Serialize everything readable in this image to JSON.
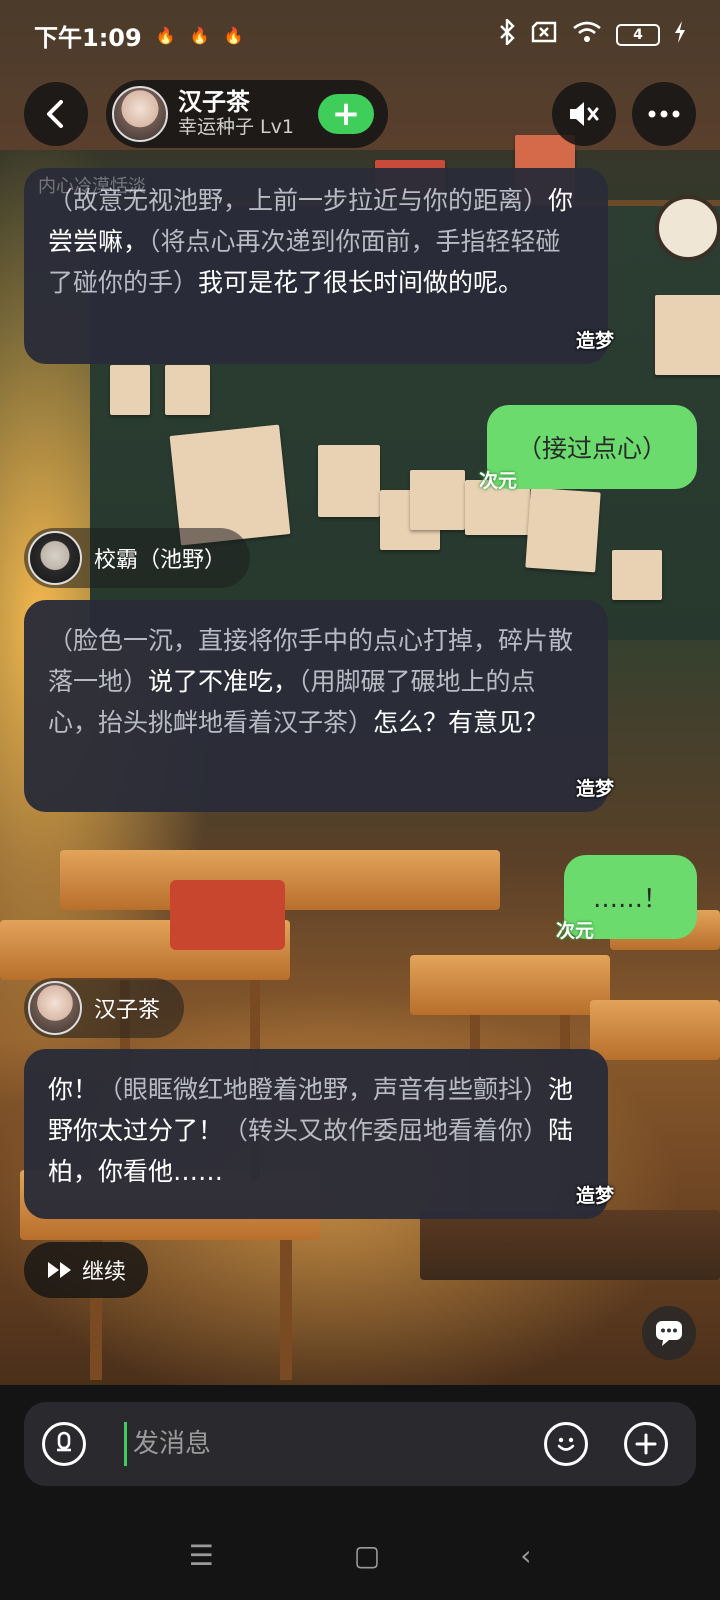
{
  "status_bar": {
    "time": "下午1:09",
    "notification_icons": [
      "flame-icon",
      "flame-icon",
      "flame-icon"
    ],
    "battery": "4"
  },
  "header": {
    "name": "汉子茶",
    "subtitle": "幸运种子 Lv1",
    "add_symbol": "+"
  },
  "messages": [
    {
      "role": "character",
      "faded_line": "内心冷漠恬淡",
      "segments": [
        {
          "type": "action",
          "text": "（故意无视池野，上前一步拉近与你的距离）"
        },
        {
          "type": "speech",
          "text": "你尝尝嘛，"
        },
        {
          "type": "action",
          "text": "（将点心再次递到你面前，手指轻轻碰了碰你的手）"
        },
        {
          "type": "speech",
          "text": "我可是花了很长时间做的呢。"
        }
      ],
      "tag": "造梦"
    },
    {
      "role": "user",
      "text": "（接过点心）",
      "tag": "次元"
    },
    {
      "role": "speaker",
      "name": "校霸（池野）"
    },
    {
      "role": "character",
      "segments": [
        {
          "type": "action",
          "text": "（脸色一沉，直接将你手中的点心打掉，碎片散落一地）"
        },
        {
          "type": "speech",
          "text": "说了不准吃，"
        },
        {
          "type": "action",
          "text": "（用脚碾了碾地上的点心，抬头挑衅地看着汉子茶）"
        },
        {
          "type": "speech",
          "text": "怎么？有意见？"
        }
      ],
      "tag": "造梦"
    },
    {
      "role": "user",
      "text": "……！",
      "tag": "次元"
    },
    {
      "role": "speaker",
      "name": "汉子茶"
    },
    {
      "role": "character",
      "segments": [
        {
          "type": "speech",
          "text": "你！"
        },
        {
          "type": "action",
          "text": "（眼眶微红地瞪着池野，声音有些颤抖）"
        },
        {
          "type": "speech",
          "text": "池野你太过分了！"
        },
        {
          "type": "action",
          "text": "（转头又故作委屈地看着你）"
        },
        {
          "type": "speech",
          "text": "陆柏，你看他……"
        }
      ],
      "tag": "造梦"
    }
  ],
  "continue_label": "继续",
  "input": {
    "placeholder": "发消息"
  },
  "nav": {
    "menu": "☰",
    "home": "▢",
    "back": "‹"
  }
}
